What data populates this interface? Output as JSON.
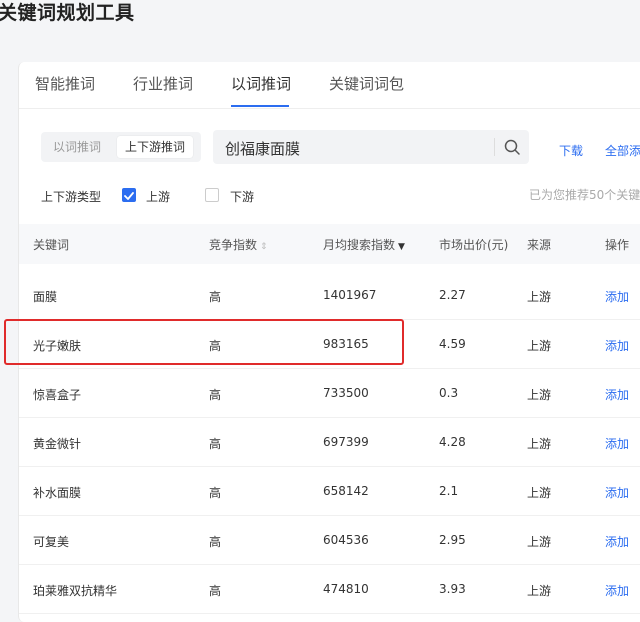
{
  "page": {
    "title": "关键词规划工具"
  },
  "tabs": [
    {
      "label": "智能推词"
    },
    {
      "label": "行业推词"
    },
    {
      "label": "以词推词",
      "active": true
    },
    {
      "label": "关键词词包"
    }
  ],
  "mode_switch": [
    {
      "label": "以词推词"
    },
    {
      "label": "上下游推词",
      "active": true
    }
  ],
  "search": {
    "value": "创福康面膜"
  },
  "actions": {
    "download": "下载",
    "add_all": "全部添"
  },
  "filter": {
    "label": "上下游类型",
    "options": [
      {
        "label": "上游",
        "checked": true
      },
      {
        "label": "下游",
        "checked": false
      }
    ]
  },
  "recommend_text": "已为您推荐50个关键",
  "table": {
    "columns": [
      "关键词",
      "竞争指数",
      "月均搜索指数",
      "市场出价(元)",
      "来源",
      "操作"
    ],
    "rows": [
      {
        "keyword": "面膜",
        "competition": "高",
        "search_index": "1401967",
        "price": "2.27",
        "source": "上游",
        "action": "添加"
      },
      {
        "keyword": "光子嫩肤",
        "competition": "高",
        "search_index": "983165",
        "price": "4.59",
        "source": "上游",
        "action": "添加"
      },
      {
        "keyword": "惊喜盒子",
        "competition": "高",
        "search_index": "733500",
        "price": "0.3",
        "source": "上游",
        "action": "添加"
      },
      {
        "keyword": "黄金微针",
        "competition": "高",
        "search_index": "697399",
        "price": "4.28",
        "source": "上游",
        "action": "添加"
      },
      {
        "keyword": "补水面膜",
        "competition": "高",
        "search_index": "658142",
        "price": "2.1",
        "source": "上游",
        "action": "添加"
      },
      {
        "keyword": "可复美",
        "competition": "高",
        "search_index": "604536",
        "price": "2.95",
        "source": "上游",
        "action": "添加"
      },
      {
        "keyword": "珀莱雅双抗精华",
        "competition": "高",
        "search_index": "474810",
        "price": "3.93",
        "source": "上游",
        "action": "添加"
      }
    ]
  },
  "colors": {
    "accent": "#2c6df0",
    "highlight": "#e02b2b"
  }
}
